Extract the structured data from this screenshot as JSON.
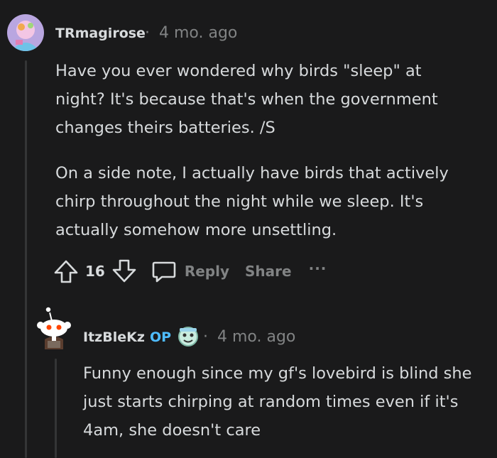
{
  "comments": [
    {
      "author": "TRmagirose",
      "separator": "·",
      "time": "4 mo. ago",
      "paragraphs": [
        "Have you ever wondered why birds \"sleep\" at night? It's because that's when the government changes theirs batteries. /S",
        "On a side note, I actually have birds that actively chirp throughout the night while we sleep. It's actually somehow more unsettling."
      ],
      "votes": "16",
      "reply_label": "Reply",
      "share_label": "Share",
      "more_label": "···"
    },
    {
      "author": "ItzBleKz",
      "op_badge": "OP",
      "separator": "·",
      "time": "4 mo. ago",
      "paragraphs": [
        "Funny enough since my gf's lovebird is blind she just starts chirping at random times even if it's 4am, she doesn't care"
      ]
    }
  ],
  "colors": {
    "background": "#1a1a1b",
    "text": "#d7dadc",
    "muted": "#818384",
    "op": "#4fbcff",
    "thread": "#343536"
  },
  "icons": [
    "upvote-icon",
    "downvote-icon",
    "comment-icon",
    "more-icon",
    "flair-icon"
  ]
}
